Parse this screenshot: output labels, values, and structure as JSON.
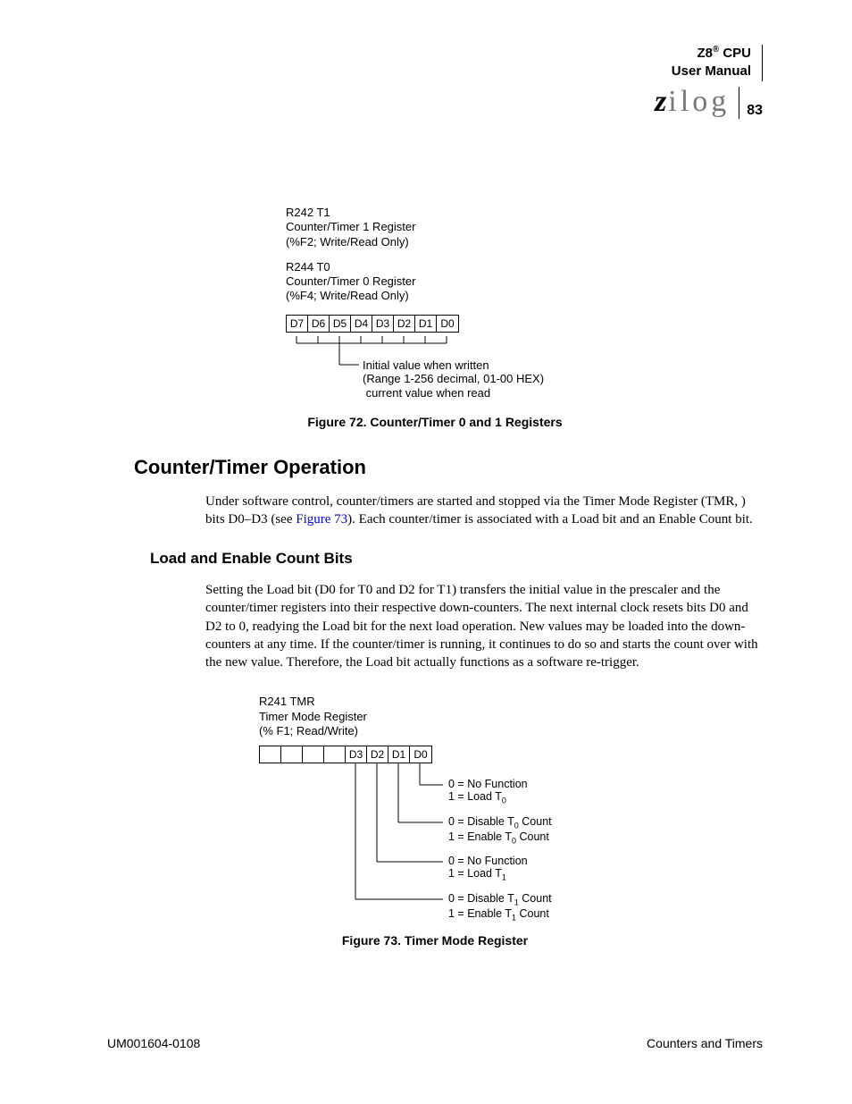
{
  "header": {
    "title_line1": "Z8® CPU",
    "title_line2": "User Manual",
    "logo_text": "ilog",
    "logo_z": "z",
    "page_number": "83"
  },
  "figure72": {
    "reg1_line1": "R242 T1",
    "reg1_line2": "Counter/Timer 1 Register",
    "reg1_line3": "(%F2; Write/Read Only)",
    "reg2_line1": "R244 T0",
    "reg2_line2": "Counter/Timer 0 Register",
    "reg2_line3": "(%F4; Write/Read Only)",
    "bits": [
      "D7",
      "D6",
      "D5",
      "D4",
      "D3",
      "D2",
      "D1",
      "D0"
    ],
    "callout_line1": "Initial value when written",
    "callout_line2": "(Range 1-256 decimal, 01-00 HEX)",
    "callout_line3": "current value when read",
    "caption": "Figure 72. Counter/Timer 0 and 1 Registers"
  },
  "section": {
    "heading": "Counter/Timer Operation",
    "para1_a": "Under software control, counter/timers are started and stopped via the Timer Mode Register (TMR, ",
    "para1_b": ") bits D0–D3 (see ",
    "para1_link": "Figure 73",
    "para1_c": "). Each counter/timer is associated with a Load bit and an Enable Count bit.",
    "subheading": "Load and Enable Count Bits",
    "para2": "Setting the Load bit (D0 for T0 and D2 for T1) transfers the initial value in the prescaler and the counter/timer registers into their respective down-counters. The next internal clock resets bits D0 and D2 to 0, readying the Load bit for the next load operation. New values may be loaded into the down-counters at any time. If the counter/timer is running, it continues to do so and starts the count over with the new value. Therefore, the Load bit actually functions as a software re-trigger."
  },
  "figure73": {
    "reg_line1": "R241 TMR",
    "reg_line2": "Timer Mode Register",
    "reg_line3": "(% F1; Read/Write)",
    "bits": [
      "",
      "",
      "",
      "",
      "D3",
      "D2",
      "D1",
      "D0"
    ],
    "d0_0": "0 = No Function",
    "d0_1": "1 = Load T",
    "d0_sub": "0",
    "d1_0a": "0 = Disable T",
    "d1_0b": "  Count",
    "d1_1a": "1 = Enable T",
    "d1_1b": "  Count",
    "d1_sub": "0",
    "d2_0": "0 = No Function",
    "d2_1": "1 = Load T",
    "d2_sub": "1",
    "d3_0a": "0 = Disable T",
    "d3_0b": "  Count",
    "d3_1a": "1 = Enable T",
    "d3_1b": "  Count",
    "d3_sub": "1",
    "caption": "Figure 73. Timer Mode Register"
  },
  "footer": {
    "left": "UM001604-0108",
    "right": "Counters and Timers"
  },
  "chart_data": [
    {
      "type": "table",
      "title": "Figure 72. Counter/Timer 0 and 1 Registers",
      "registers": [
        {
          "name": "R242 T1",
          "desc": "Counter/Timer 1 Register",
          "addr": "%F2",
          "access": "Write/Read Only"
        },
        {
          "name": "R244 T0",
          "desc": "Counter/Timer 0 Register",
          "addr": "%F4",
          "access": "Write/Read Only"
        }
      ],
      "bits": [
        "D7",
        "D6",
        "D5",
        "D4",
        "D3",
        "D2",
        "D1",
        "D0"
      ],
      "field": {
        "bits": "D7-D0",
        "write": "Initial value (Range 1-256 decimal, 01-00 HEX)",
        "read": "current value"
      }
    },
    {
      "type": "table",
      "title": "Figure 73. Timer Mode Register",
      "register": {
        "name": "R241 TMR",
        "desc": "Timer Mode Register",
        "addr": "% F1",
        "access": "Read/Write"
      },
      "bits_shown": [
        "D3",
        "D2",
        "D1",
        "D0"
      ],
      "fields": [
        {
          "bit": "D0",
          "0": "No Function",
          "1": "Load T0"
        },
        {
          "bit": "D1",
          "0": "Disable T0 Count",
          "1": "Enable T0 Count"
        },
        {
          "bit": "D2",
          "0": "No Function",
          "1": "Load T1"
        },
        {
          "bit": "D3",
          "0": "Disable T1 Count",
          "1": "Enable T1 Count"
        }
      ]
    }
  ]
}
